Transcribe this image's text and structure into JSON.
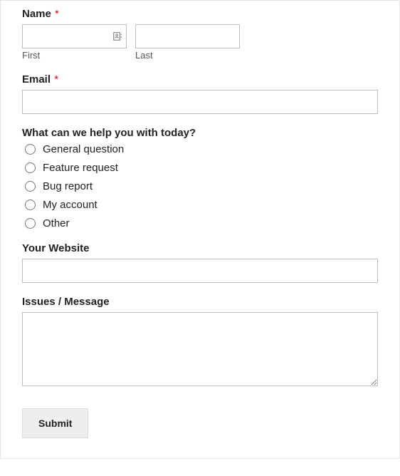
{
  "labels": {
    "name": "Name",
    "first_sub": "First",
    "last_sub": "Last",
    "email": "Email",
    "help_question": "What can we help you with today?",
    "website": "Your Website",
    "message": "Issues / Message",
    "required_marker": "*"
  },
  "options": {
    "help": [
      "General question",
      "Feature request",
      "Bug report",
      "My account",
      "Other"
    ]
  },
  "values": {
    "first_name": "",
    "last_name": "",
    "email": "",
    "website": "",
    "message": ""
  },
  "buttons": {
    "submit": "Submit"
  }
}
